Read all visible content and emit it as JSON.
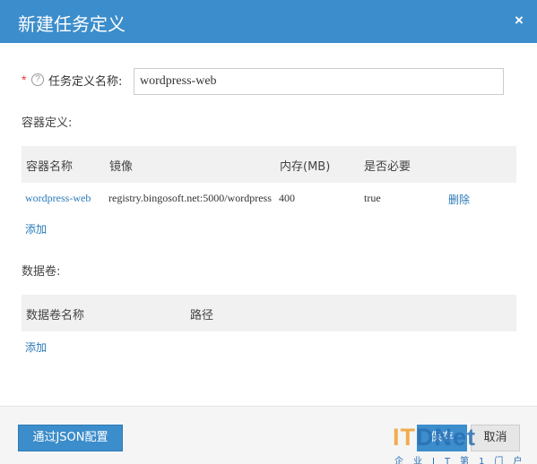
{
  "header": {
    "title": "新建任务定义",
    "close_symbol": "×"
  },
  "form": {
    "required_mark": "*",
    "help_symbol": "?",
    "name_label": "任务定义名称:",
    "name_value": "wordpress-web"
  },
  "containers": {
    "section_title": "容器定义:",
    "columns": [
      "容器名称",
      "镜像",
      "内存(MB)",
      "是否必要"
    ],
    "rows": [
      {
        "name": "wordpress-web",
        "image": "registry.bingosoft.net:5000/wordpress",
        "memory": "400",
        "essential": "true",
        "action": "删除"
      }
    ],
    "add_label": "添加"
  },
  "volumes": {
    "section_title": "数据卷:",
    "columns": [
      "数据卷名称",
      "路径"
    ],
    "add_label": "添加"
  },
  "footer": {
    "json_button": "通过JSON配置",
    "save_button": "保存",
    "cancel_button": "取消"
  },
  "watermark": {
    "logo_part1": "IT",
    "logo_part2": "DNet",
    "subtitle": "企业IT第1门户"
  }
}
